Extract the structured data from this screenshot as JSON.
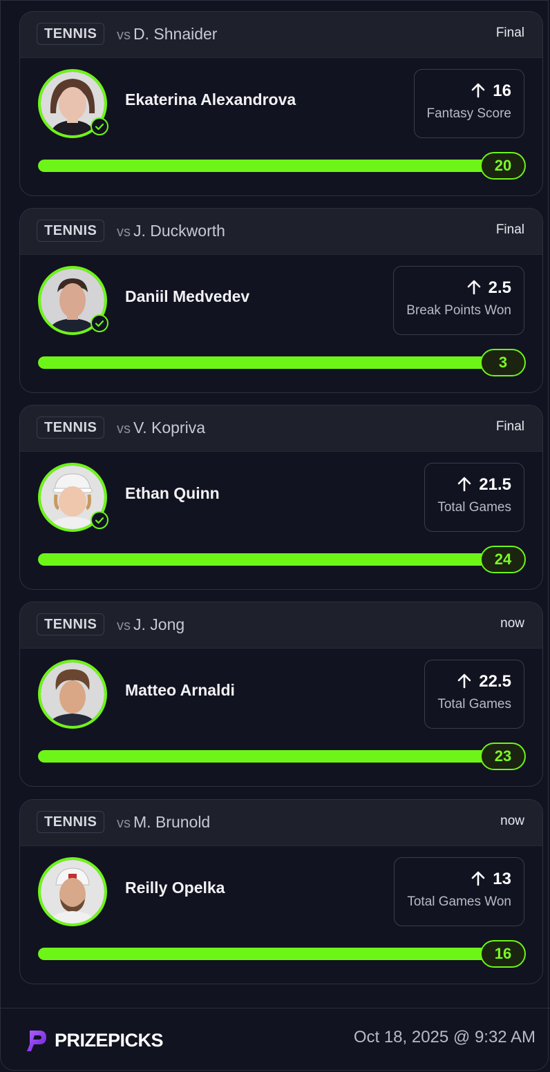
{
  "cards": [
    {
      "sport": "TENNIS",
      "vs": "vs",
      "opponent": "D. Shnaider",
      "status": "Final",
      "player": "Ekaterina Alexandrova",
      "line": "16",
      "stat": "Fantasy Score",
      "result": "20",
      "progress": 1.0,
      "completed": true
    },
    {
      "sport": "TENNIS",
      "vs": "vs",
      "opponent": "J. Duckworth",
      "status": "Final",
      "player": "Daniil Medvedev",
      "line": "2.5",
      "stat": "Break Points Won",
      "result": "3",
      "progress": 1.0,
      "completed": true
    },
    {
      "sport": "TENNIS",
      "vs": "vs",
      "opponent": "V. Kopriva",
      "status": "Final",
      "player": "Ethan Quinn",
      "line": "21.5",
      "stat": "Total Games",
      "result": "24",
      "progress": 1.0,
      "completed": true
    },
    {
      "sport": "TENNIS",
      "vs": "vs",
      "opponent": "J. Jong",
      "status": "now",
      "player": "Matteo Arnaldi",
      "line": "22.5",
      "stat": "Total Games",
      "result": "23",
      "progress": 1.0,
      "completed": false
    },
    {
      "sport": "TENNIS",
      "vs": "vs",
      "opponent": "M. Brunold",
      "status": "now",
      "player": "Reilly Opelka",
      "line": "13",
      "stat": "Total Games Won",
      "result": "16",
      "progress": 1.0,
      "completed": false
    }
  ],
  "footer": {
    "brand": "PRIZEPICKS",
    "timestamp": "Oct 18, 2025 @ 9:32 AM"
  },
  "colors": {
    "accent": "#6ef518",
    "background": "#111320",
    "card_header": "#1e202c",
    "brand_purple": "#8a3cf5"
  },
  "icons": [
    "arrow-up-icon",
    "check-circle-icon",
    "player-photo",
    "prizepicks-logo-icon"
  ]
}
